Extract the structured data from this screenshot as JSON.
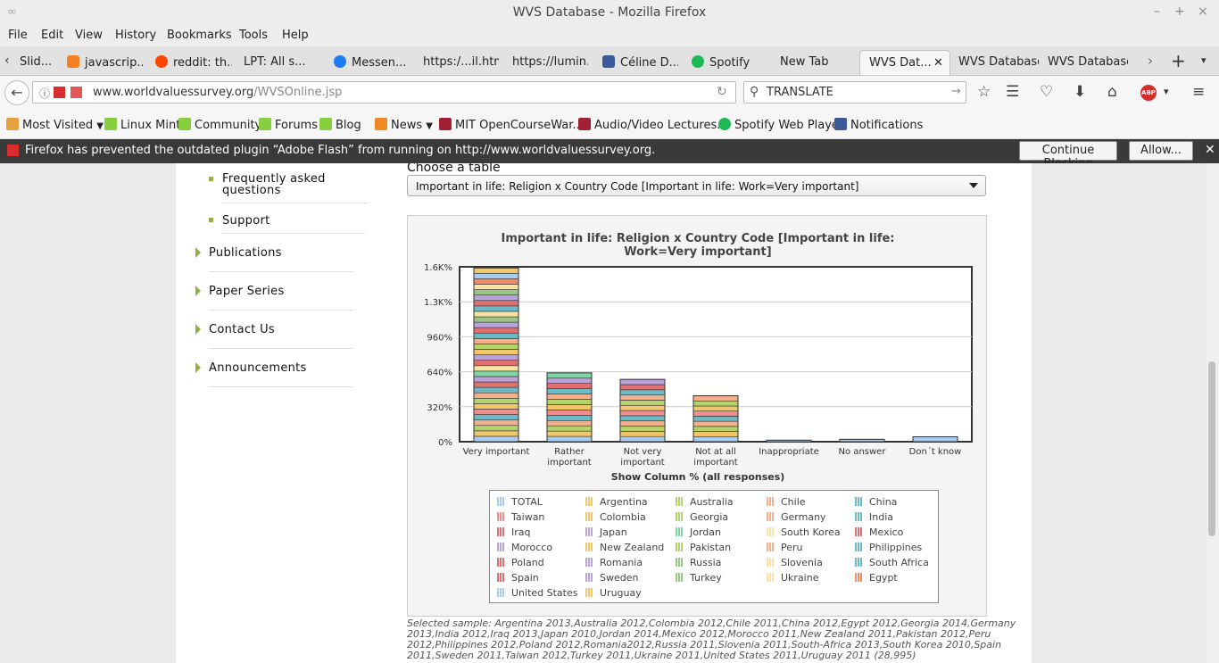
{
  "window": {
    "title": "WVS Database - Mozilla Firefox",
    "controls": [
      "–",
      "+",
      "×"
    ]
  },
  "menu": [
    "File",
    "Edit",
    "View",
    "History",
    "Bookmarks",
    "Tools",
    "Help"
  ],
  "tabs": [
    {
      "label": "Slid...",
      "color": "#c8c8c8"
    },
    {
      "label": "javascrip...",
      "color": "#f48024"
    },
    {
      "label": "reddit: th...",
      "color": "#ff4500"
    },
    {
      "label": "LPT: All s...",
      "color": "#ff4500"
    },
    {
      "label": "Messen...",
      "color": "#1e7cf2"
    },
    {
      "label": "https:/...il.html",
      "color": ""
    },
    {
      "label": "https://lumin...",
      "color": ""
    },
    {
      "label": "Céline D...",
      "color": "#3b5998"
    },
    {
      "label": "Spotify",
      "color": "#1db954"
    },
    {
      "label": "New Tab",
      "color": ""
    },
    {
      "label": "WVS Dat...",
      "color": "",
      "active": true
    },
    {
      "label": "WVS Database",
      "color": ""
    },
    {
      "label": "WVS Database",
      "color": ""
    }
  ],
  "nav": {
    "url_domain": "www.worldvaluessurvey.org",
    "url_path": "/WVSOnline.jsp",
    "search_value": "TRANSLATE"
  },
  "bookmarks": [
    {
      "label": "Most Visited",
      "color": "#e8a13c",
      "dropdown": true
    },
    {
      "label": "Linux Mint",
      "color": "#87cf3e"
    },
    {
      "label": "Community",
      "color": "#87cf3e"
    },
    {
      "label": "Forums",
      "color": "#87cf3e"
    },
    {
      "label": "Blog",
      "color": "#87cf3e"
    },
    {
      "label": "News",
      "color": "#f08a24",
      "dropdown": true
    },
    {
      "label": "MIT OpenCourseWar...",
      "color": "#a31f34"
    },
    {
      "label": "Audio/Video Lectures...",
      "color": "#a31f34"
    },
    {
      "label": "Spotify Web Player",
      "color": "#1db954"
    },
    {
      "label": "Notifications",
      "color": "#3b5998"
    }
  ],
  "plugin_bar": {
    "message": "Firefox has prevented the outdated plugin “Adobe Flash” from running on http://www.worldvaluessurvey.org.",
    "continue_label": "Continue Blocking",
    "allow_label": "Allow..."
  },
  "sidebar": {
    "sub_items": [
      "Frequently asked questions",
      "Support"
    ],
    "items": [
      "Publications",
      "Paper Series",
      "Contact Us",
      "Announcements"
    ]
  },
  "main": {
    "choose_label": "Choose a table",
    "selected_table": "Important in life: Religion x Country Code [Important in life: Work=Very important]",
    "show_label": "Show Column % (all responses)",
    "sample_text": "Selected sample: Argentina 2013,Australia 2012,Colombia 2012,Chile 2011,China 2012,Egypt 2012,Georgia 2014,Germany 2013,India 2012,Iraq 2013,Japan 2010,Jordan 2014,Mexico 2012,Morocco 2011,New Zealand 2011,Pakistan 2012,Peru 2012,Philippines 2012,Poland 2012,Romania2012,Russia 2011,Slovenia 2011,South-Africa 2013,South Korea 2010,Spain 2011,Sweden 2011,Taiwan 2012,Turkey 2011,Ukraine 2011,United States 2011,Uruguay 2011 (28,995)"
  },
  "chart_data": {
    "type": "bar",
    "title": "Important in life: Religion x Country Code [Important in life: Work=Very important]",
    "xlabel": "",
    "ylabel": "",
    "categories": [
      "Very important",
      "Rather important",
      "Not very important",
      "Not at all important",
      "Inappropriate",
      "No answer",
      "Don´t know"
    ],
    "category_lines": [
      [
        "Very important"
      ],
      [
        "Rather",
        "important"
      ],
      [
        "Not very",
        "important"
      ],
      [
        "Not at all",
        "important"
      ],
      [
        "Inappropriate"
      ],
      [
        "No answer"
      ],
      [
        "Don´t know"
      ]
    ],
    "stacked_totals": [
      1590,
      630,
      570,
      420,
      14,
      22,
      45
    ],
    "yticks": [
      "0%",
      "320%",
      "640%",
      "960%",
      "1.3K%",
      "1.6K%"
    ],
    "ylim": [
      0,
      1600
    ],
    "grid": true,
    "legend_position": "bottom",
    "series_names": [
      "TOTAL",
      "Argentina",
      "Australia",
      "Chile",
      "China",
      "Taiwan",
      "Colombia",
      "Georgia",
      "Germany",
      "India",
      "Iraq",
      "Japan",
      "Jordan",
      "South Korea",
      "Mexico",
      "Morocco",
      "New Zealand",
      "Pakistan",
      "Peru",
      "Philippines",
      "Poland",
      "Romania",
      "Russia",
      "Slovenia",
      "South Africa",
      "Spain",
      "Sweden",
      "Turkey",
      "Ukraine",
      "Egypt",
      "United States",
      "Uruguay"
    ],
    "series_colors": [
      "#a8cdf0",
      "#f2c66a",
      "#b5d36d",
      "#f3b08c",
      "#6cbac6",
      "#f08d8d",
      "#f2c66a",
      "#b5d36d",
      "#f3b08c",
      "#6cbac6",
      "#e07070",
      "#b9a2d8",
      "#7fd6a2",
      "#f7e3a2",
      "#e07070",
      "#b9a2d8",
      "#f2c66a",
      "#b5d36d",
      "#f3b08c",
      "#6cbac6",
      "#e07070",
      "#b9a2d8",
      "#9ac68a",
      "#f7e3a2",
      "#6cbac6",
      "#e07070",
      "#b9a2d8",
      "#9ac68a",
      "#f7e3a2",
      "#f08d6c",
      "#a8cdf0",
      "#f2c66a"
    ]
  }
}
